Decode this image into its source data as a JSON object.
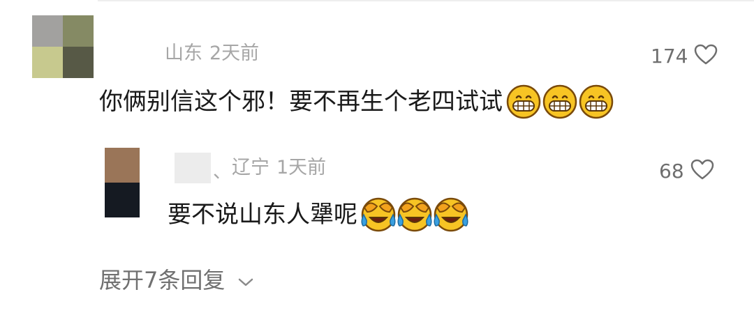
{
  "comment": {
    "location": "山东",
    "time": "2天前",
    "likes": "174",
    "text": "你俩别信这个邪！要不再生个老四试试",
    "emoji_name": "grin-emoji",
    "emoji_count": 3
  },
  "reply": {
    "separator": "、",
    "location": "辽宁",
    "time": "1天前",
    "likes": "68",
    "text": "要不说山东人犟呢",
    "emoji_name": "crying-laughing-emoji",
    "emoji_count": 3
  },
  "expand_replies_label": "展开7条回复",
  "icons": {
    "heart": "heart-outline-icon",
    "chevron": "chevron-down-icon"
  },
  "colors": {
    "meta_text": "#a6a6a6",
    "body_text": "#1a1a1a",
    "like_text": "#6e6e6e",
    "emoji_yellow": "#f7c424"
  }
}
